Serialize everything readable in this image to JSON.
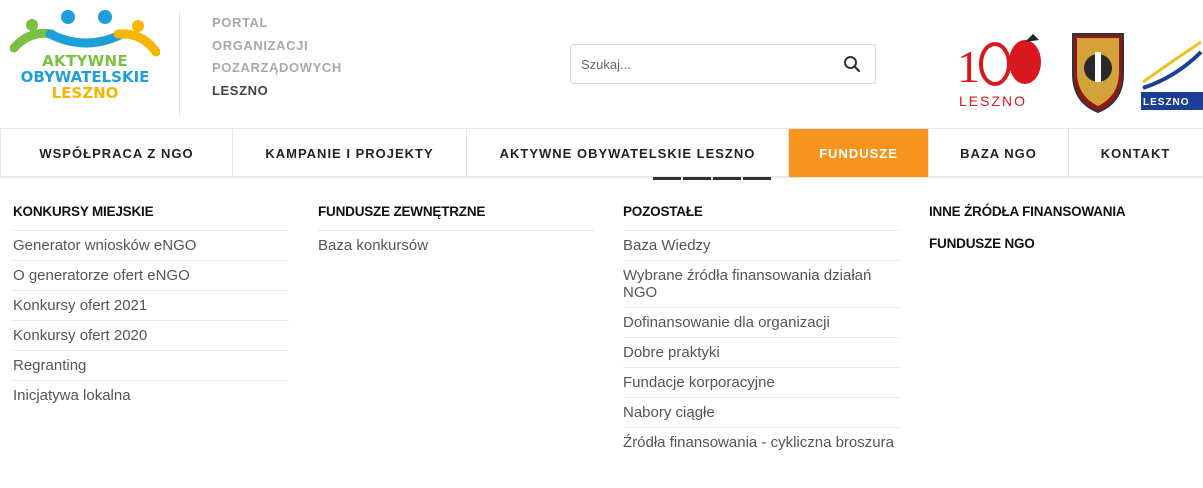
{
  "logo": {
    "line1": "AKTYWNE",
    "line2": "OBYWATELSKIE",
    "line3": "LESZNO"
  },
  "portal": {
    "line1": "PORTAL",
    "line2": "ORGANIZACJI",
    "line3": "POZARZĄDOWYCH",
    "line4": "LESZNO"
  },
  "search": {
    "placeholder": "Szukaj...",
    "icon": "search-icon"
  },
  "partners": {
    "badge_text": "LESZNO",
    "leszno_logo_text": "LESZNO"
  },
  "nav": {
    "items": [
      {
        "label": "WSPÓŁPRACA Z NGO"
      },
      {
        "label": "KAMPANIE I PROJEKTY"
      },
      {
        "label": "AKTYWNE OBYWATELSKIE LESZNO"
      },
      {
        "label": "FUNDUSZE"
      },
      {
        "label": "BAZA NGO"
      },
      {
        "label": "KONTAKT"
      }
    ],
    "active": "FUNDUSZE",
    "accent": "#f7941d"
  },
  "menu": {
    "col1": {
      "title": "KONKURSY MIEJSKIE",
      "links": [
        "Generator wniosków eNGO",
        "O generatorze ofert eNGO",
        "Konkursy ofert 2021",
        "Konkursy ofert 2020",
        "Regranting",
        "Inicjatywa lokalna"
      ]
    },
    "col2": {
      "title": "FUNDUSZE ZEWNĘTRZNE",
      "links": [
        "Baza konkursów"
      ]
    },
    "col3": {
      "title": "POZOSTAŁE",
      "links": [
        "Baza Wiedzy",
        "Wybrane źródła finansowania działań NGO",
        "Dofinansowanie dla organizacji",
        "Dobre praktyki",
        "Fundacje korporacyjne",
        "Nabory ciągłe",
        "Źródła finansowania - cykliczna broszura"
      ]
    },
    "col4": {
      "title": "INNE ŹRÓDŁA FINANSOWANIA",
      "title2": "FUNDUSZE NGO"
    }
  }
}
